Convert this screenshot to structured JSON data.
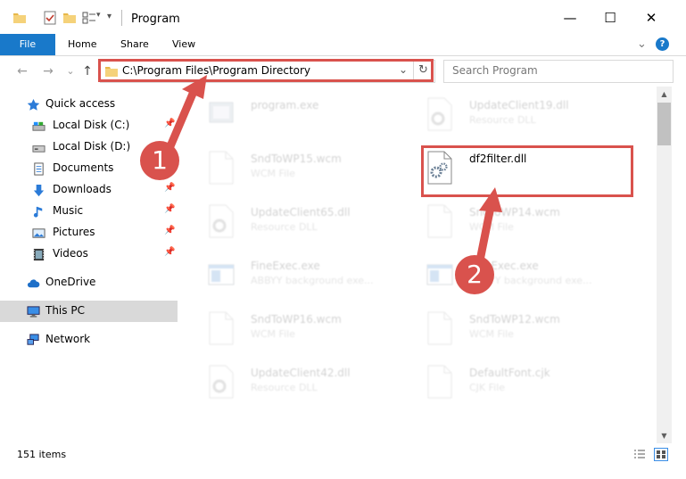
{
  "window": {
    "title": "Program",
    "minimize_glyph": "—",
    "maximize_glyph": "☐",
    "close_glyph": "✕"
  },
  "ribbon": {
    "tabs": [
      "File",
      "Home",
      "Share",
      "View"
    ],
    "expand_glyph": "⌄",
    "help_glyph": "?"
  },
  "nav": {
    "back_glyph": "←",
    "forward_glyph": "→",
    "recent_glyph": "⌄",
    "up_glyph": "↑"
  },
  "address": {
    "path": "C:\\Program Files\\Program Directory",
    "dropdown_glyph": "⌄",
    "refresh_glyph": "↻"
  },
  "search": {
    "placeholder": "Search Program"
  },
  "sidebar": {
    "items": [
      {
        "label": "Quick access",
        "icon": "star-icon",
        "pinned": false
      },
      {
        "label": "Local Disk (C:)",
        "icon": "drive-icon",
        "pinned": true
      },
      {
        "label": "Local Disk (D:)",
        "icon": "drive-icon",
        "pinned": false
      },
      {
        "label": "Documents",
        "icon": "document-icon",
        "pinned": true
      },
      {
        "label": "Downloads",
        "icon": "download-icon",
        "pinned": true
      },
      {
        "label": "Music",
        "icon": "music-icon",
        "pinned": true
      },
      {
        "label": "Pictures",
        "icon": "pictures-icon",
        "pinned": true
      },
      {
        "label": "Videos",
        "icon": "videos-icon",
        "pinned": true
      },
      {
        "label": "OneDrive",
        "icon": "cloud-icon",
        "pinned": false
      },
      {
        "label": "This PC",
        "icon": "computer-icon",
        "pinned": false
      },
      {
        "label": "Network",
        "icon": "network-icon",
        "pinned": false
      }
    ],
    "pin_glyph": "📌"
  },
  "files": [
    {
      "name": "program.exe",
      "type": "",
      "icon": "exe-icon"
    },
    {
      "name": "UpdateClient19.dll",
      "type": "Resource DLL",
      "icon": "dll-icon"
    },
    {
      "name": "SndToWP15.wcm",
      "type": "WCM File",
      "icon": "file-icon"
    },
    {
      "name": "df2filter.dll",
      "type": "",
      "icon": "dll-gear-icon"
    },
    {
      "name": "UpdateClient65.dll",
      "type": "Resource DLL",
      "icon": "dll-icon"
    },
    {
      "name": "SndToWP14.wcm",
      "type": "WCM File",
      "icon": "file-icon"
    },
    {
      "name": "FineExec.exe",
      "type": "ABBYY background exe...",
      "icon": "app-window-icon"
    },
    {
      "name": "FineExec.exe",
      "type": "ABBYY background exe...",
      "icon": "app-window-icon"
    },
    {
      "name": "SndToWP16.wcm",
      "type": "WCM File",
      "icon": "file-icon"
    },
    {
      "name": "SndToWP12.wcm",
      "type": "WCM File",
      "icon": "file-icon"
    },
    {
      "name": "UpdateClient42.dll",
      "type": "Resource DLL",
      "icon": "dll-icon"
    },
    {
      "name": "DefaultFont.cjk",
      "type": "CJK File",
      "icon": "file-icon"
    }
  ],
  "status": {
    "item_count": "151 items"
  },
  "annotations": {
    "badge_1": "1",
    "badge_2": "2"
  },
  "colors": {
    "accent": "#1979ca",
    "highlight": "#d9524d",
    "selection": "#d9d9d9"
  }
}
